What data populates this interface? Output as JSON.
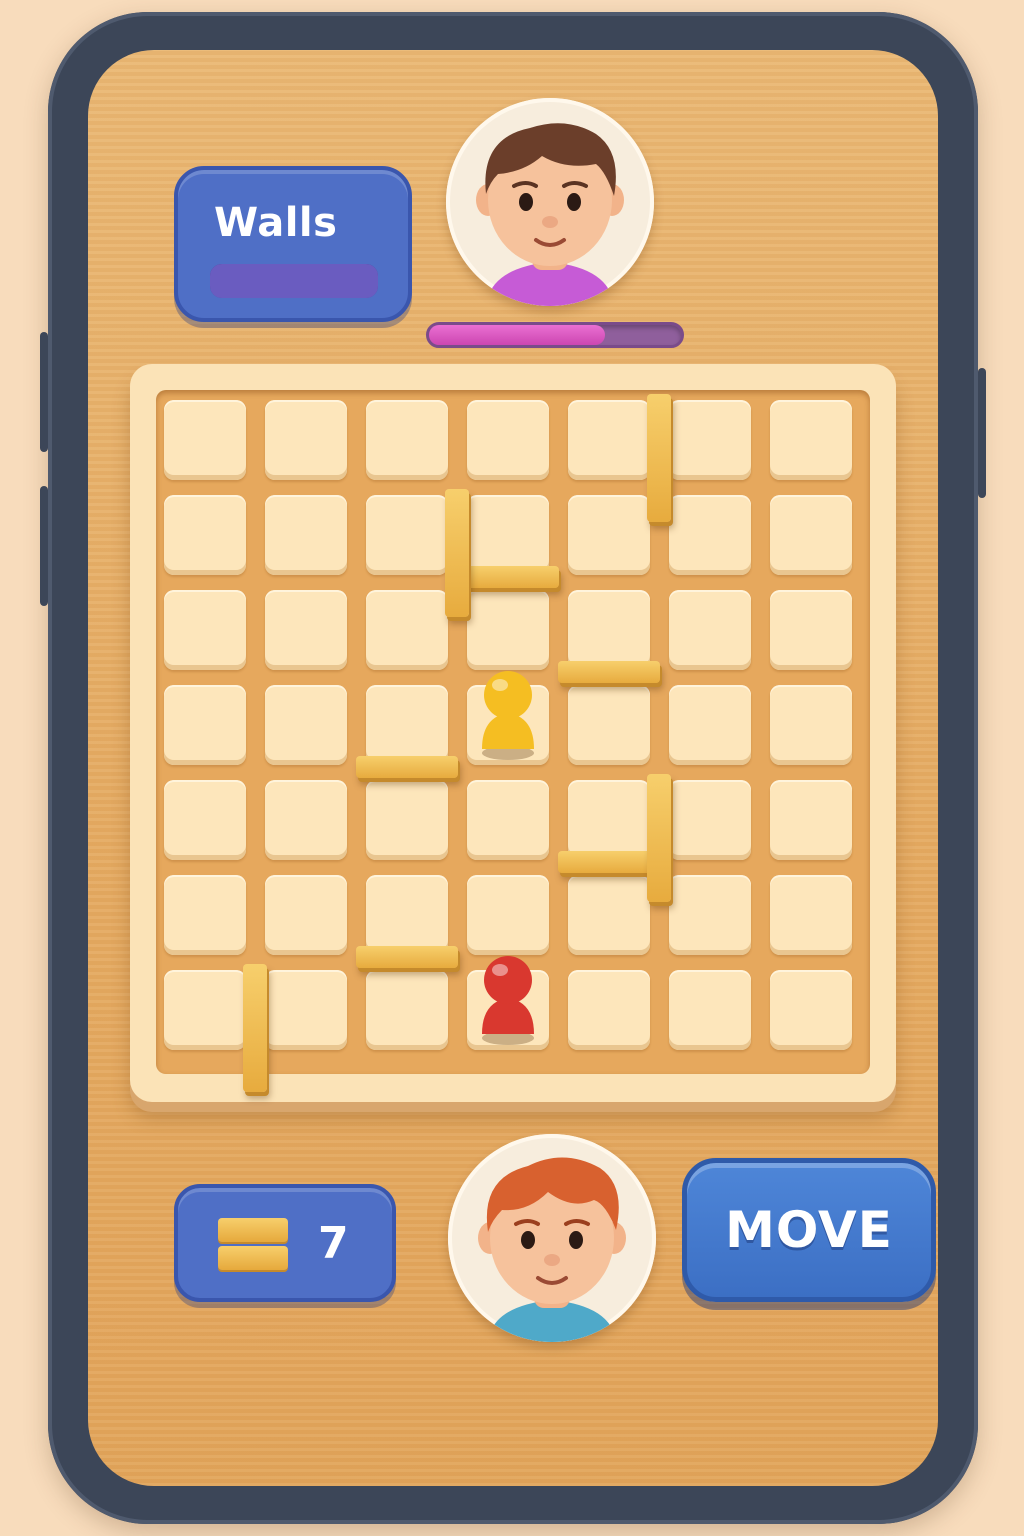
{
  "walls_panel": {
    "title": "Walls",
    "bar_fill_fraction": 1.0
  },
  "opponent": {
    "avatar_icon": "boy-brown-hair-avatar-icon",
    "shirt_color": "#c65bd6",
    "health_fraction": 0.7
  },
  "player": {
    "avatar_icon": "boy-red-hair-avatar-icon",
    "shirt_color": "#4fa9c9",
    "walls_remaining": "7"
  },
  "move_button": {
    "label": "MOVE"
  },
  "board": {
    "rows": 7,
    "cols": 7,
    "pawns": [
      {
        "color": "#f5be22",
        "row": 3,
        "col": 3
      },
      {
        "color": "#d9382f",
        "row": 6,
        "col": 3
      }
    ],
    "walls": [
      {
        "orientation": "vertical",
        "row": 0,
        "col": 5
      },
      {
        "orientation": "horizontal",
        "row": 1,
        "col": 3
      },
      {
        "orientation": "vertical",
        "row": 1,
        "col": 3
      },
      {
        "orientation": "horizontal",
        "row": 2,
        "col": 4
      },
      {
        "orientation": "horizontal",
        "row": 3,
        "col": 2
      },
      {
        "orientation": "horizontal",
        "row": 4,
        "col": 4
      },
      {
        "orientation": "vertical",
        "row": 4,
        "col": 5
      },
      {
        "orientation": "horizontal",
        "row": 5,
        "col": 2
      },
      {
        "orientation": "vertical",
        "row": 6,
        "col": 1
      }
    ]
  }
}
